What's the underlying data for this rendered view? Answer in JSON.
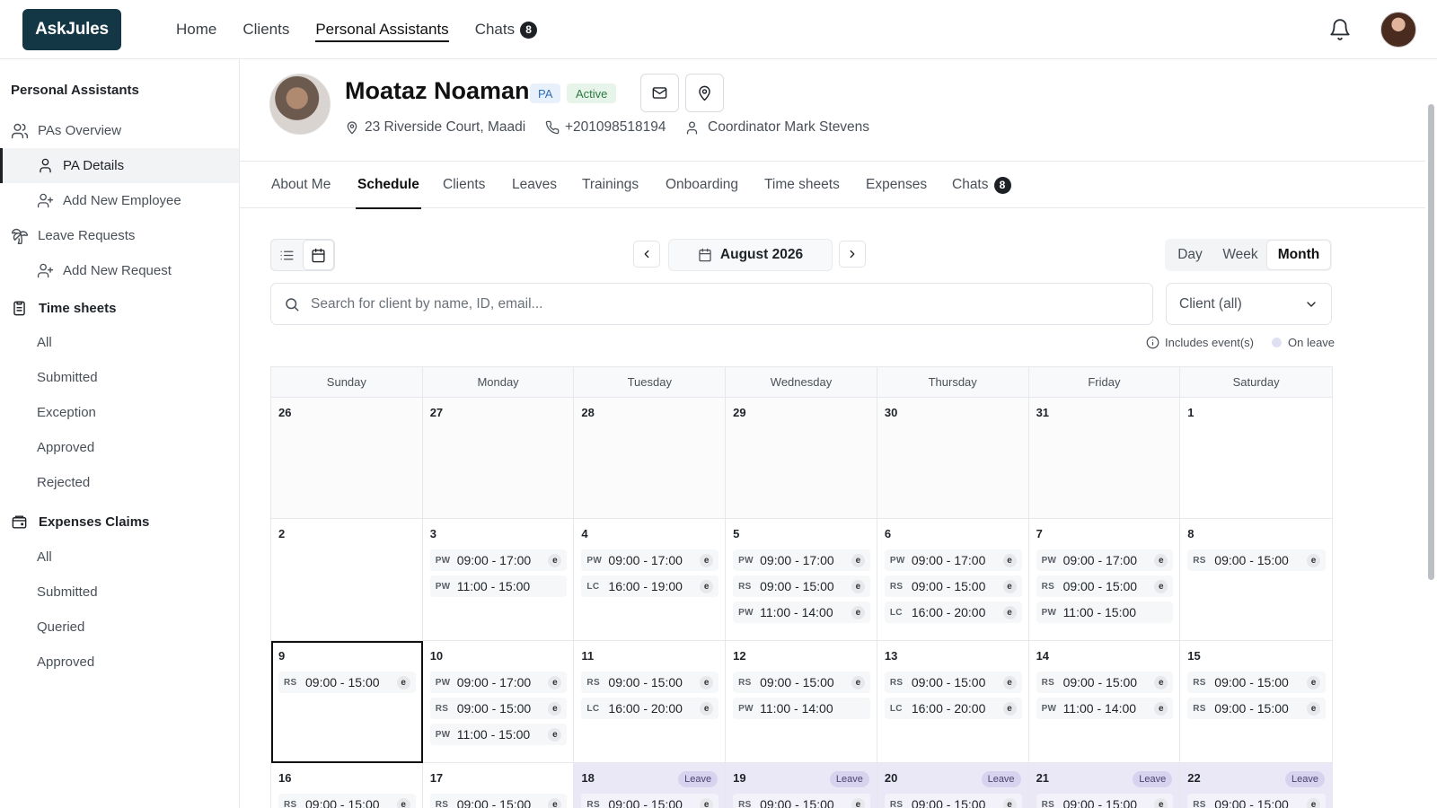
{
  "app": {
    "logo": "AskJules"
  },
  "topnav": [
    {
      "label": "Home"
    },
    {
      "label": "Clients"
    },
    {
      "label": "Personal Assistants",
      "active": true
    },
    {
      "label": "Chats",
      "badge": "8"
    }
  ],
  "sidebar": {
    "title": "Personal Assistants",
    "pas_overview": "PAs Overview",
    "pa_details": "PA Details",
    "add_new_employee": "Add New Employee",
    "leave_requests": "Leave Requests",
    "add_new_request": "Add New Request",
    "timesheets_title": "Time sheets",
    "timesheets": [
      "All",
      "Submitted",
      "Exception",
      "Approved",
      "Rejected"
    ],
    "expenses_title": "Expenses Claims",
    "expenses": [
      "All",
      "Submitted",
      "Queried",
      "Approved"
    ]
  },
  "profile": {
    "name": "Moataz Noaman",
    "role_tag": "PA",
    "status_tag": "Active",
    "address": "23 Riverside Court, Maadi",
    "phone": "+201098518194",
    "coordinator": "Coordinator Mark Stevens"
  },
  "tabs": [
    {
      "label": "About Me"
    },
    {
      "label": "Schedule",
      "active": true
    },
    {
      "label": "Clients"
    },
    {
      "label": "Leaves"
    },
    {
      "label": "Trainings"
    },
    {
      "label": "Onboarding"
    },
    {
      "label": "Time sheets"
    },
    {
      "label": "Expenses"
    },
    {
      "label": "Chats",
      "badge": "8"
    }
  ],
  "toolbar": {
    "month": "August 2026",
    "ranges": [
      "Day",
      "Week",
      "Month"
    ],
    "active_range": "Month",
    "search_placeholder": "Search for client by name, ID, email...",
    "client_filter": "Client (all)"
  },
  "legend": {
    "includes_events": "Includes event(s)",
    "on_leave": "On leave"
  },
  "calendar": {
    "weekdays": [
      "Sunday",
      "Monday",
      "Tuesday",
      "Wednesday",
      "Thursday",
      "Friday",
      "Saturday"
    ],
    "leave_label": "Leave",
    "days": [
      {
        "num": "26",
        "other": true,
        "events": []
      },
      {
        "num": "27",
        "other": true,
        "events": []
      },
      {
        "num": "28",
        "other": true,
        "events": []
      },
      {
        "num": "29",
        "other": true,
        "events": []
      },
      {
        "num": "30",
        "other": true,
        "events": []
      },
      {
        "num": "31",
        "other": true,
        "events": []
      },
      {
        "num": "1",
        "events": []
      },
      {
        "num": "2",
        "events": []
      },
      {
        "num": "3",
        "events": [
          {
            "code": "PW",
            "time": "09:00 - 17:00",
            "e": true
          },
          {
            "code": "PW",
            "time": "11:00 - 15:00",
            "e": false
          }
        ]
      },
      {
        "num": "4",
        "events": [
          {
            "code": "PW",
            "time": "09:00 - 17:00",
            "e": true
          },
          {
            "code": "LC",
            "time": "16:00 - 19:00",
            "e": true
          }
        ]
      },
      {
        "num": "5",
        "events": [
          {
            "code": "PW",
            "time": "09:00 - 17:00",
            "e": true
          },
          {
            "code": "RS",
            "time": "09:00 - 15:00",
            "e": true
          },
          {
            "code": "PW",
            "time": "11:00 - 14:00",
            "e": true
          }
        ]
      },
      {
        "num": "6",
        "events": [
          {
            "code": "PW",
            "time": "09:00 - 17:00",
            "e": true
          },
          {
            "code": "RS",
            "time": "09:00 - 15:00",
            "e": true
          },
          {
            "code": "LC",
            "time": "16:00 - 20:00",
            "e": true
          }
        ]
      },
      {
        "num": "7",
        "events": [
          {
            "code": "PW",
            "time": "09:00 - 17:00",
            "e": true
          },
          {
            "code": "RS",
            "time": "09:00 - 15:00",
            "e": true
          },
          {
            "code": "PW",
            "time": "11:00 - 15:00",
            "e": false
          }
        ]
      },
      {
        "num": "8",
        "events": [
          {
            "code": "RS",
            "time": "09:00 - 15:00",
            "e": true
          }
        ]
      },
      {
        "num": "9",
        "selected": true,
        "events": [
          {
            "code": "RS",
            "time": "09:00 - 15:00",
            "e": true
          }
        ]
      },
      {
        "num": "10",
        "events": [
          {
            "code": "PW",
            "time": "09:00 - 17:00",
            "e": true
          },
          {
            "code": "RS",
            "time": "09:00 - 15:00",
            "e": true
          },
          {
            "code": "PW",
            "time": "11:00 - 15:00",
            "e": true
          }
        ]
      },
      {
        "num": "11",
        "events": [
          {
            "code": "RS",
            "time": "09:00 - 15:00",
            "e": true
          },
          {
            "code": "LC",
            "time": "16:00 - 20:00",
            "e": true
          }
        ]
      },
      {
        "num": "12",
        "events": [
          {
            "code": "RS",
            "time": "09:00 - 15:00",
            "e": true
          },
          {
            "code": "PW",
            "time": "11:00 - 14:00",
            "e": false
          }
        ]
      },
      {
        "num": "13",
        "events": [
          {
            "code": "RS",
            "time": "09:00 - 15:00",
            "e": true
          },
          {
            "code": "LC",
            "time": "16:00 - 20:00",
            "e": true
          }
        ]
      },
      {
        "num": "14",
        "events": [
          {
            "code": "RS",
            "time": "09:00 - 15:00",
            "e": true
          },
          {
            "code": "PW",
            "time": "11:00 - 14:00",
            "e": true
          }
        ]
      },
      {
        "num": "15",
        "events": [
          {
            "code": "RS",
            "time": "09:00 - 15:00",
            "e": true
          },
          {
            "code": "RS",
            "time": "09:00 - 15:00",
            "e": true
          }
        ]
      },
      {
        "num": "16",
        "events": [
          {
            "code": "RS",
            "time": "09:00 - 15:00",
            "e": true
          }
        ]
      },
      {
        "num": "17",
        "events": [
          {
            "code": "RS",
            "time": "09:00 - 15:00",
            "e": true
          }
        ]
      },
      {
        "num": "18",
        "leave": true,
        "events": [
          {
            "code": "RS",
            "time": "09:00 - 15:00",
            "e": true
          }
        ]
      },
      {
        "num": "19",
        "leave": true,
        "events": [
          {
            "code": "RS",
            "time": "09:00 - 15:00",
            "e": true
          }
        ]
      },
      {
        "num": "20",
        "leave": true,
        "events": [
          {
            "code": "RS",
            "time": "09:00 - 15:00",
            "e": true
          }
        ]
      },
      {
        "num": "21",
        "leave": true,
        "events": [
          {
            "code": "RS",
            "time": "09:00 - 15:00",
            "e": true
          }
        ]
      },
      {
        "num": "22",
        "leave": true,
        "events": [
          {
            "code": "RS",
            "time": "09:00 - 15:00",
            "e": true
          }
        ]
      }
    ]
  },
  "icons": {
    "bell": "bell-icon",
    "mail": "mail-icon",
    "location": "map-pin-icon",
    "phone": "phone-icon",
    "user": "user-icon",
    "calendar": "calendar-icon",
    "list": "list-icon",
    "search": "search-icon"
  },
  "colors": {
    "brand": "#143746",
    "leave_bg": "#eae8f7",
    "pa_tag": "#2f6db5",
    "active_tag": "#2c7a40"
  }
}
